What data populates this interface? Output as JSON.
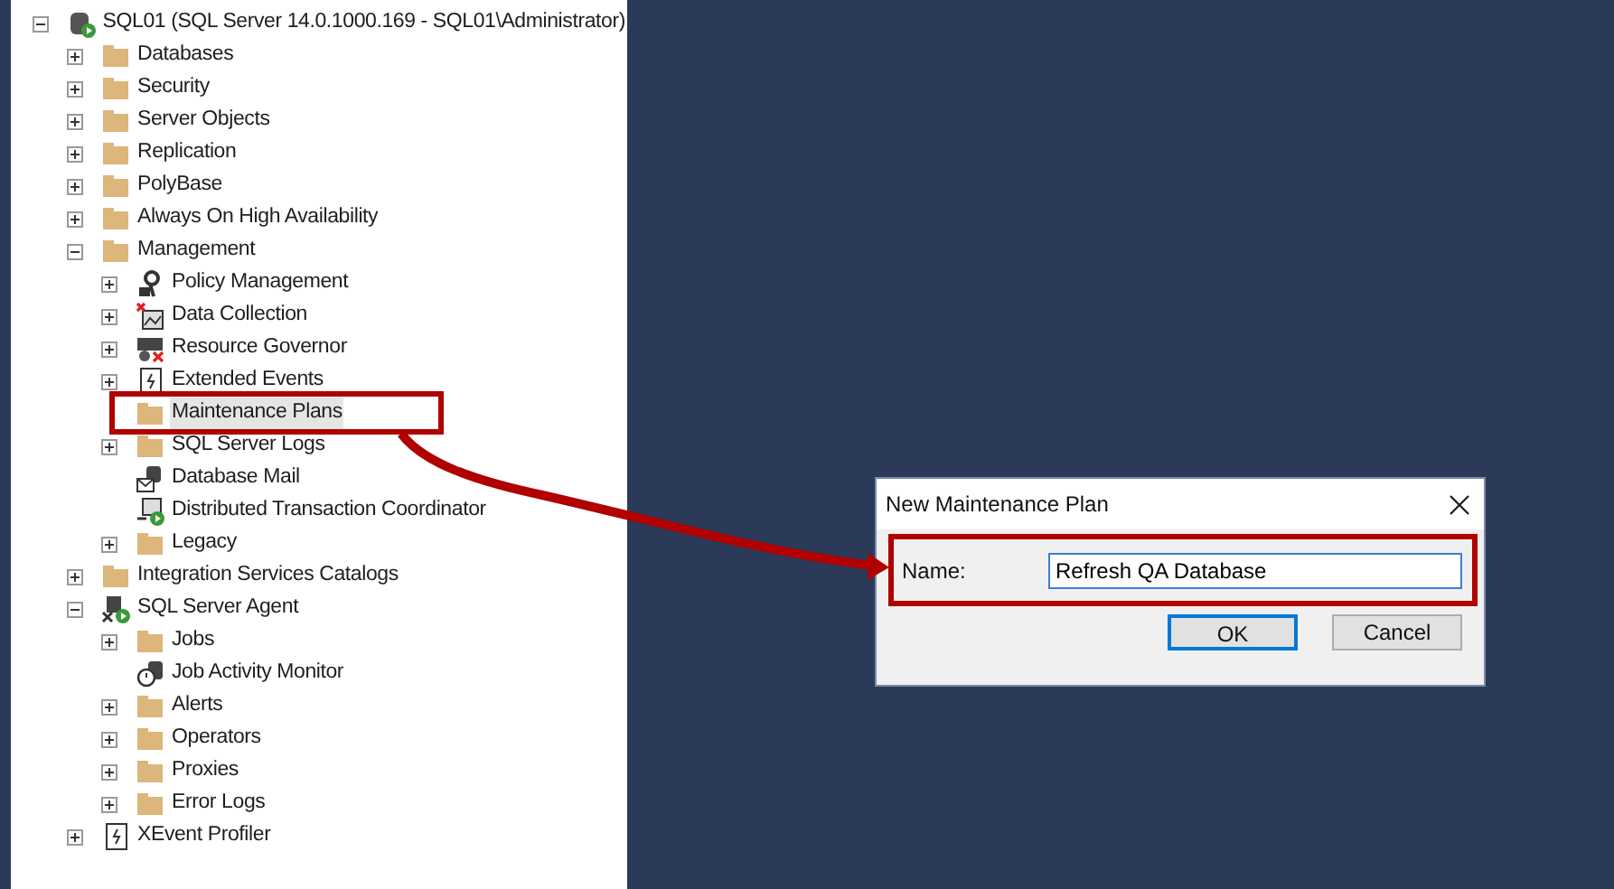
{
  "tree": [
    {
      "label": "SQL01 (SQL Server 14.0.1000.169 - SQL01\\Administrator)",
      "kind": "server",
      "expanded": true,
      "selected": false,
      "children": [
        {
          "label": "Databases",
          "kind": "folder",
          "expanded": false,
          "selected": false
        },
        {
          "label": "Security",
          "kind": "folder",
          "expanded": false,
          "selected": false
        },
        {
          "label": "Server Objects",
          "kind": "folder",
          "expanded": false,
          "selected": false
        },
        {
          "label": "Replication",
          "kind": "folder",
          "expanded": false,
          "selected": false
        },
        {
          "label": "PolyBase",
          "kind": "folder",
          "expanded": false,
          "selected": false
        },
        {
          "label": "Always On High Availability",
          "kind": "folder",
          "expanded": false,
          "selected": false
        },
        {
          "label": "Management",
          "kind": "folder",
          "expanded": true,
          "selected": false,
          "children": [
            {
              "label": "Policy Management",
              "kind": "policy",
              "expanded": false,
              "selected": false
            },
            {
              "label": "Data Collection",
              "kind": "collection",
              "expanded": false,
              "selected": false
            },
            {
              "label": "Resource Governor",
              "kind": "governor",
              "expanded": false,
              "selected": false
            },
            {
              "label": "Extended Events",
              "kind": "events",
              "expanded": false,
              "selected": false
            },
            {
              "label": "Maintenance Plans",
              "kind": "folder",
              "selected": true
            },
            {
              "label": "SQL Server Logs",
              "kind": "folder",
              "expanded": false,
              "selected": false
            },
            {
              "label": "Database Mail",
              "kind": "mail",
              "selected": false
            },
            {
              "label": "Distributed Transaction Coordinator",
              "kind": "dtc",
              "selected": false
            },
            {
              "label": "Legacy",
              "kind": "folder",
              "expanded": false,
              "selected": false
            }
          ]
        },
        {
          "label": "Integration Services Catalogs",
          "kind": "folder",
          "expanded": false,
          "selected": false
        },
        {
          "label": "SQL Server Agent",
          "kind": "agent",
          "expanded": true,
          "selected": false,
          "children": [
            {
              "label": "Jobs",
              "kind": "folder",
              "expanded": false,
              "selected": false
            },
            {
              "label": "Job Activity Monitor",
              "kind": "monitor",
              "selected": false
            },
            {
              "label": "Alerts",
              "kind": "folder",
              "expanded": false,
              "selected": false
            },
            {
              "label": "Operators",
              "kind": "folder",
              "expanded": false,
              "selected": false
            },
            {
              "label": "Proxies",
              "kind": "folder",
              "expanded": false,
              "selected": false
            },
            {
              "label": "Error Logs",
              "kind": "folder",
              "expanded": false,
              "selected": false
            }
          ]
        },
        {
          "label": "XEvent Profiler",
          "kind": "events",
          "expanded": false,
          "selected": false
        }
      ]
    }
  ],
  "dialog": {
    "title": "New Maintenance Plan",
    "name_label": "Name:",
    "name_value": "Refresh QA Database",
    "buttons": [
      {
        "label": "OK",
        "default": true
      },
      {
        "label": "Cancel",
        "default": false
      }
    ]
  }
}
